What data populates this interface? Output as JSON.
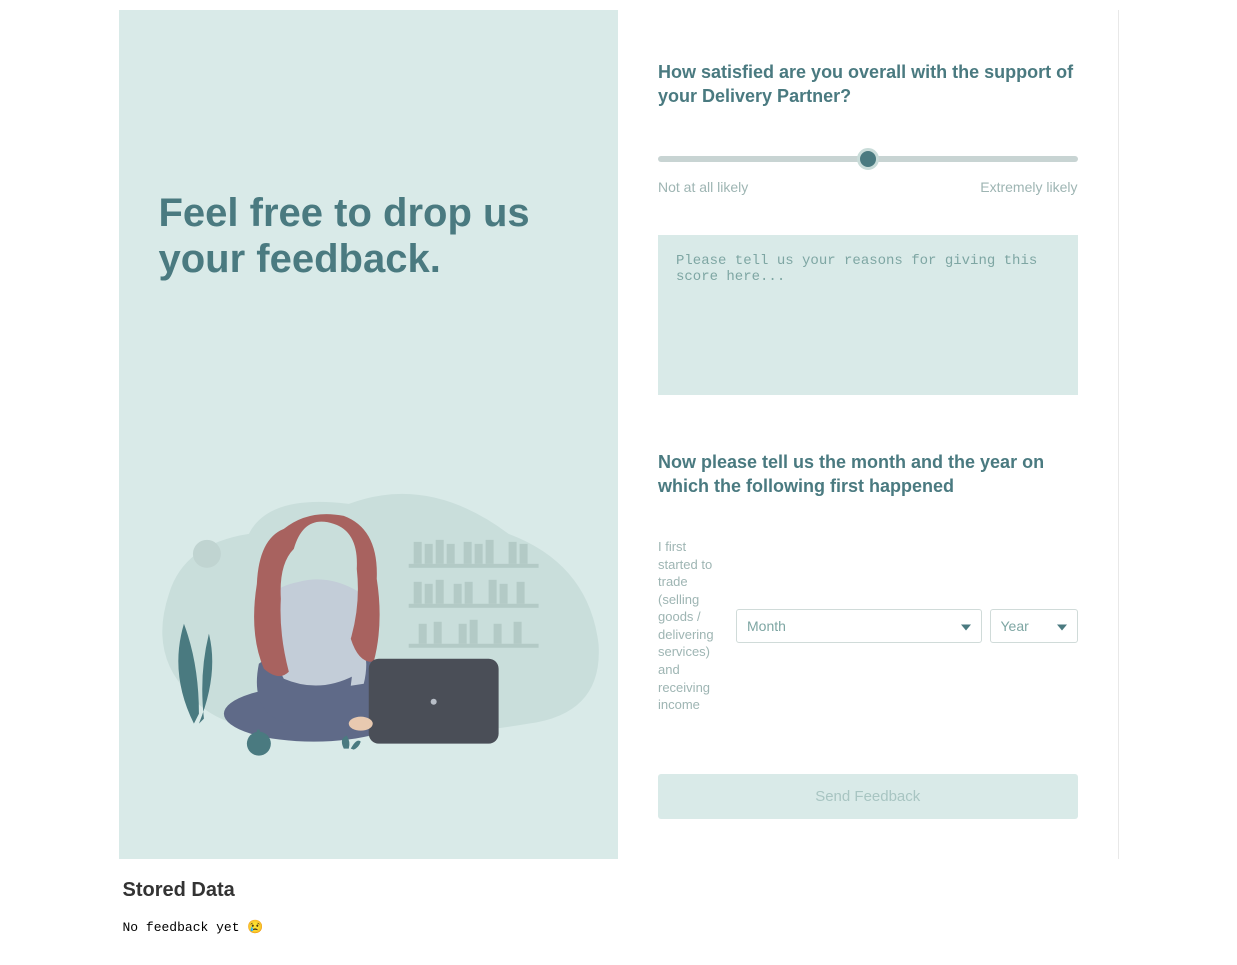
{
  "left": {
    "headline": "Feel free to drop us your feedback."
  },
  "form": {
    "q1": "How satisfied are you overall with the support of your Delivery Partner?",
    "slider": {
      "min_label": "Not at all likely",
      "max_label": "Extremely likely",
      "value": 5,
      "min": 0,
      "max": 10
    },
    "textarea_placeholder": "Please tell us your reasons for giving this score here...",
    "q2": "Now please tell us the month and the year on which the following first happened",
    "date_label": "I first started to trade (selling goods / delivering services) and receiving income",
    "month_placeholder": "Month",
    "year_placeholder": "Year",
    "submit_label": "Send Feedback"
  },
  "stored": {
    "heading": "Stored Data",
    "empty_text": "No feedback yet ",
    "empty_emoji": "😢"
  }
}
